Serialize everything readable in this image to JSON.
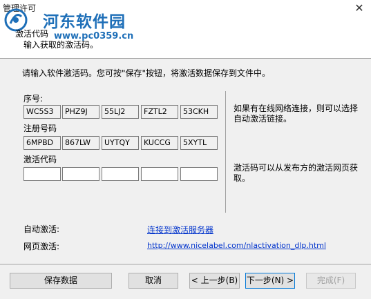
{
  "window": {
    "title": "管理许可",
    "close_glyph": "✕"
  },
  "watermark": {
    "name": "河东软件园",
    "url": "www.pc0359.cn"
  },
  "header": {
    "title": "激活代码",
    "subtitle": "输入获取的激活码。"
  },
  "intro": "请输入软件激活码。您可按\"保存\"按钮，将激活数据保存到文件中。",
  "serial": {
    "label": "序号:",
    "values": [
      "WC5S3",
      "PHZ9J",
      "55LJ2",
      "FZTL2",
      "53CKH"
    ]
  },
  "registration": {
    "label": "注册号码",
    "values": [
      "6MPBD",
      "867LW",
      "UYTQY",
      "KUCCG",
      "5XYTL"
    ]
  },
  "activation": {
    "label": "激活代码",
    "values": [
      "",
      "",
      "",
      "",
      ""
    ]
  },
  "notes": {
    "online": "如果有在线网络连接，则可以选择自动激活链接。",
    "web": "激活码可以从发布方的激活网页获取。"
  },
  "auto_activation": {
    "label": "自动激活:",
    "link": "连接到激活服务器"
  },
  "web_activation": {
    "label": "网页激活:",
    "link": "http://www.nicelabel.com/nlactivation_dlp.html"
  },
  "buttons": {
    "save": "保存数据",
    "cancel": "取消",
    "back": "< 上一步(B)",
    "next": "下一步(N) >",
    "finish": "完成(F)"
  },
  "colors": {
    "link": "#0033cc",
    "watermark": "#1e6fb8",
    "logo": "#1e6fb8",
    "default_button_border": "#0078d7"
  }
}
